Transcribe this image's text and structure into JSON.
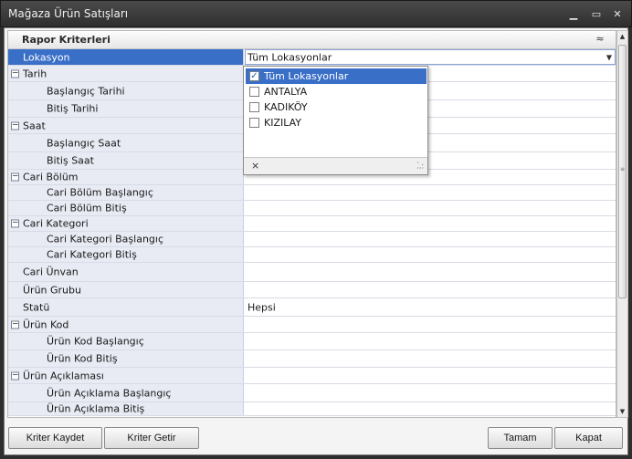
{
  "window": {
    "title": "Mağaza Ürün Satışları",
    "min_glyph": "▁",
    "max_glyph": "▭",
    "close_glyph": "✕"
  },
  "category": {
    "title": "Rapor Kriterleri",
    "collapse_glyph": "≈"
  },
  "rows": [
    {
      "label": "Lokasyon",
      "value": "Tüm Lokasyonlar",
      "type": "selected"
    },
    {
      "label": "Tarih",
      "type": "group"
    },
    {
      "label": "Başlangıç Tarihi",
      "type": "child"
    },
    {
      "label": "Bitiş Tarihi",
      "type": "child"
    },
    {
      "label": "Saat",
      "type": "group"
    },
    {
      "label": "Başlangıç Saat",
      "type": "child"
    },
    {
      "label": "Bitiş Saat",
      "type": "child"
    },
    {
      "label": "Cari Bölüm",
      "type": "group"
    },
    {
      "label": "Cari Bölüm Başlangıç",
      "type": "child"
    },
    {
      "label": "Cari Bölüm Bitiş",
      "type": "child"
    },
    {
      "label": "Cari Kategori",
      "type": "group"
    },
    {
      "label": "Cari Kategori Başlangıç",
      "type": "child"
    },
    {
      "label": "Cari Kategori Bitiş",
      "type": "child"
    },
    {
      "label": "Cari Ünvan",
      "type": "item"
    },
    {
      "label": "Ürün Grubu",
      "type": "item"
    },
    {
      "label": "Statü",
      "value": "Hepsi",
      "type": "item"
    },
    {
      "label": "Ürün Kod",
      "type": "group"
    },
    {
      "label": "Ürün Kod Başlangıç",
      "type": "child"
    },
    {
      "label": "Ürün Kod Bitiş",
      "type": "child"
    },
    {
      "label": "Ürün Açıklaması",
      "type": "group"
    },
    {
      "label": "Ürün Açıklama Başlangıç",
      "type": "child"
    },
    {
      "label": "Ürün Açıklama Bitiş",
      "type": "child"
    }
  ],
  "dropdown": {
    "items": [
      {
        "label": "Tüm Lokasyonlar",
        "checked": true
      },
      {
        "label": "ANTALYA",
        "checked": false
      },
      {
        "label": "KADIKÖY",
        "checked": false
      },
      {
        "label": "KIZILAY",
        "checked": false
      }
    ],
    "clear_glyph": "×"
  },
  "buttons": {
    "save_criteria": "Kriter Kaydet",
    "load_criteria": "Kriter Getir",
    "ok": "Tamam",
    "close": "Kapat"
  }
}
